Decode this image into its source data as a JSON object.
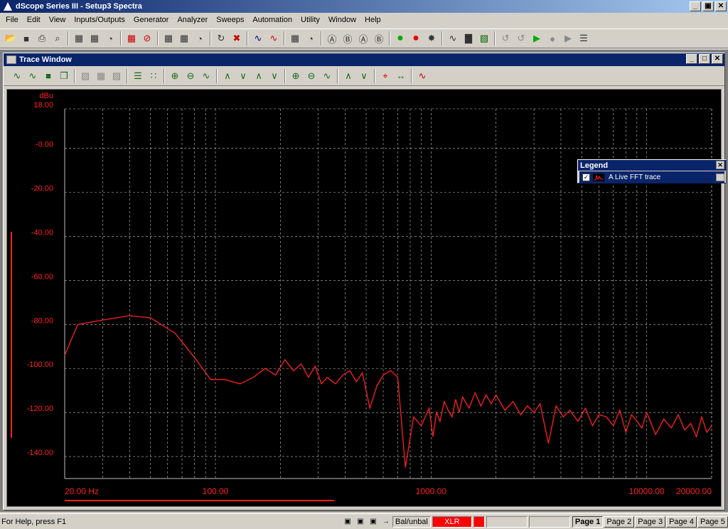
{
  "app": {
    "title": "dScope Series III - Setup3 Spectra"
  },
  "menu": [
    "File",
    "Edit",
    "View",
    "Inputs/Outputs",
    "Generator",
    "Analyzer",
    "Sweeps",
    "Automation",
    "Utility",
    "Window",
    "Help"
  ],
  "trace_window": {
    "title": "Trace Window"
  },
  "legend": {
    "title": "Legend",
    "entry": "A  Live FFT trace",
    "checked": true
  },
  "status": {
    "help": "For Help, press F1",
    "balance": "Bal/unbal",
    "connector": "XLR",
    "pages": [
      "Page 1",
      "Page 2",
      "Page 3",
      "Page 4",
      "Page 5"
    ],
    "active_page": "Page 1"
  },
  "colors": {
    "trace": "#ff2020",
    "grid": "#c0c0c0",
    "axis_label": "#ff2020",
    "background": "#000000"
  },
  "chart_data": {
    "type": "line",
    "ylabel": "dBu",
    "x_scale": "log",
    "xlim": [
      20,
      20000
    ],
    "ylim": [
      -150,
      18
    ],
    "y_ticks": [
      "18.00",
      "-0.00",
      "-20.00",
      "-40.00",
      "-60.00",
      "-80.00",
      "-100.00",
      "-120.00",
      "-140.00"
    ],
    "y_tick_values": [
      18,
      0,
      -20,
      -40,
      -60,
      -80,
      -100,
      -120,
      -140
    ],
    "x_ticks": [
      "20.00 Hz",
      "100.00",
      "1000.00",
      "10000.00",
      "20000.00"
    ],
    "x_tick_values": [
      20,
      100,
      1000,
      10000,
      20000
    ],
    "grid": true,
    "series": [
      {
        "x": [
          20,
          23,
          30,
          40,
          50,
          65,
          80,
          95,
          110,
          130,
          150,
          170,
          190,
          210,
          230,
          250,
          270,
          290,
          310,
          330,
          360,
          390,
          420,
          450,
          480,
          520,
          560,
          600,
          650,
          700,
          760,
          830,
          900,
          980,
          1020,
          1060,
          1100,
          1150,
          1200,
          1250,
          1300,
          1350,
          1400,
          1500,
          1600,
          1700,
          1800,
          1900,
          2000,
          2200,
          2400,
          2600,
          2800,
          3000,
          3200,
          3500,
          3800,
          4100,
          4400,
          4800,
          5200,
          5600,
          6000,
          6500,
          7000,
          7500,
          8000,
          8500,
          9000,
          9500,
          10000,
          11000,
          12000,
          13000,
          14000,
          15000,
          16000,
          17000,
          18000,
          19000,
          20000
        ],
        "y": [
          -94,
          -80,
          -78,
          -76,
          -77,
          -84,
          -95,
          -105,
          -105,
          -107,
          -104,
          -100,
          -103,
          -96,
          -101,
          -98,
          -104,
          -99,
          -107,
          -104,
          -107,
          -103,
          -101,
          -106,
          -102,
          -118,
          -108,
          -103,
          -101,
          -104,
          -145,
          -122,
          -126,
          -118,
          -131,
          -120,
          -124,
          -115,
          -119,
          -122,
          -114,
          -120,
          -113,
          -118,
          -111,
          -117,
          -112,
          -116,
          -112,
          -119,
          -115,
          -121,
          -117,
          -120,
          -116,
          -134,
          -117,
          -122,
          -119,
          -124,
          -118,
          -126,
          -121,
          -122,
          -126,
          -119,
          -129,
          -121,
          -124,
          -127,
          -120,
          -130,
          -123,
          -127,
          -121,
          -128,
          -125,
          -131,
          -122,
          -129,
          -126
        ]
      }
    ]
  }
}
